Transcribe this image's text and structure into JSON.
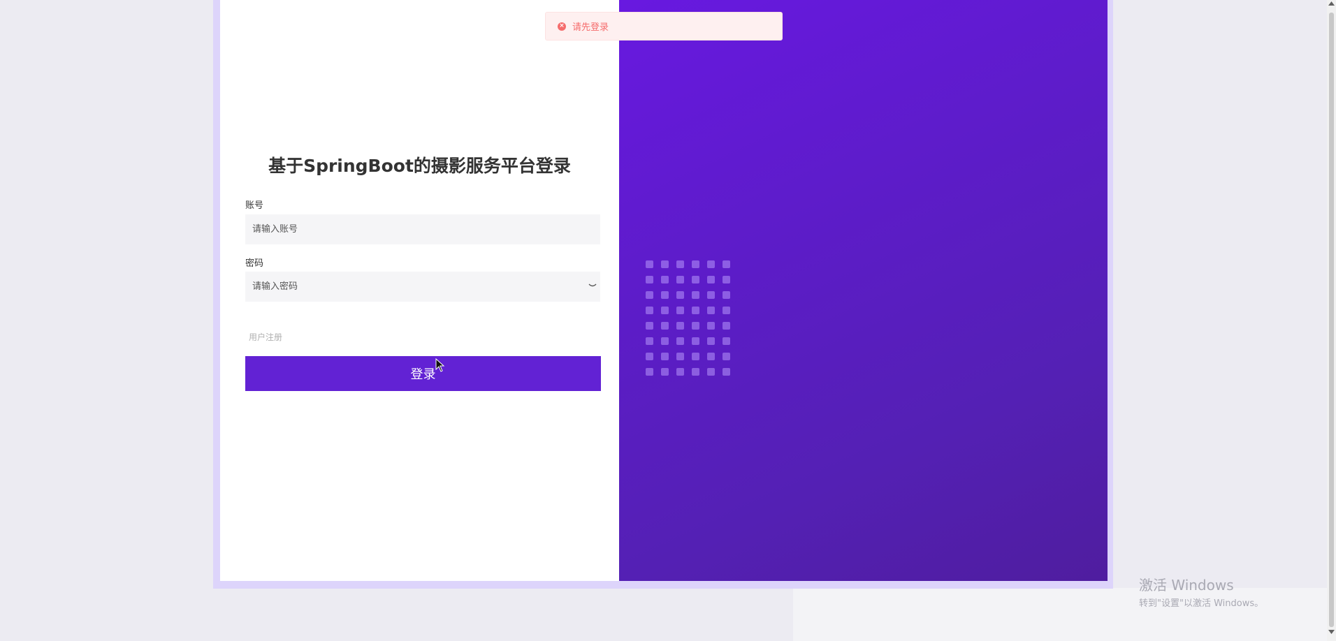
{
  "toast": {
    "message": "请先登录",
    "icon": "error-circle-icon",
    "color": "#f56c6c"
  },
  "login": {
    "title": "基于SpringBoot的摄影服务平台登录",
    "account_label": "账号",
    "account_placeholder": "请输入账号",
    "password_label": "密码",
    "password_placeholder": "请输入密码",
    "register_link": "用户注册",
    "login_button": "登录"
  },
  "watermark": {
    "title": "激活 Windows",
    "subtitle": "转到\"设置\"以激活 Windows。"
  },
  "colors": {
    "accent": "#6222d4",
    "panel_gradient_start": "#6819e0",
    "panel_gradient_end": "#4f1d9f",
    "background": "#ecebf2"
  }
}
